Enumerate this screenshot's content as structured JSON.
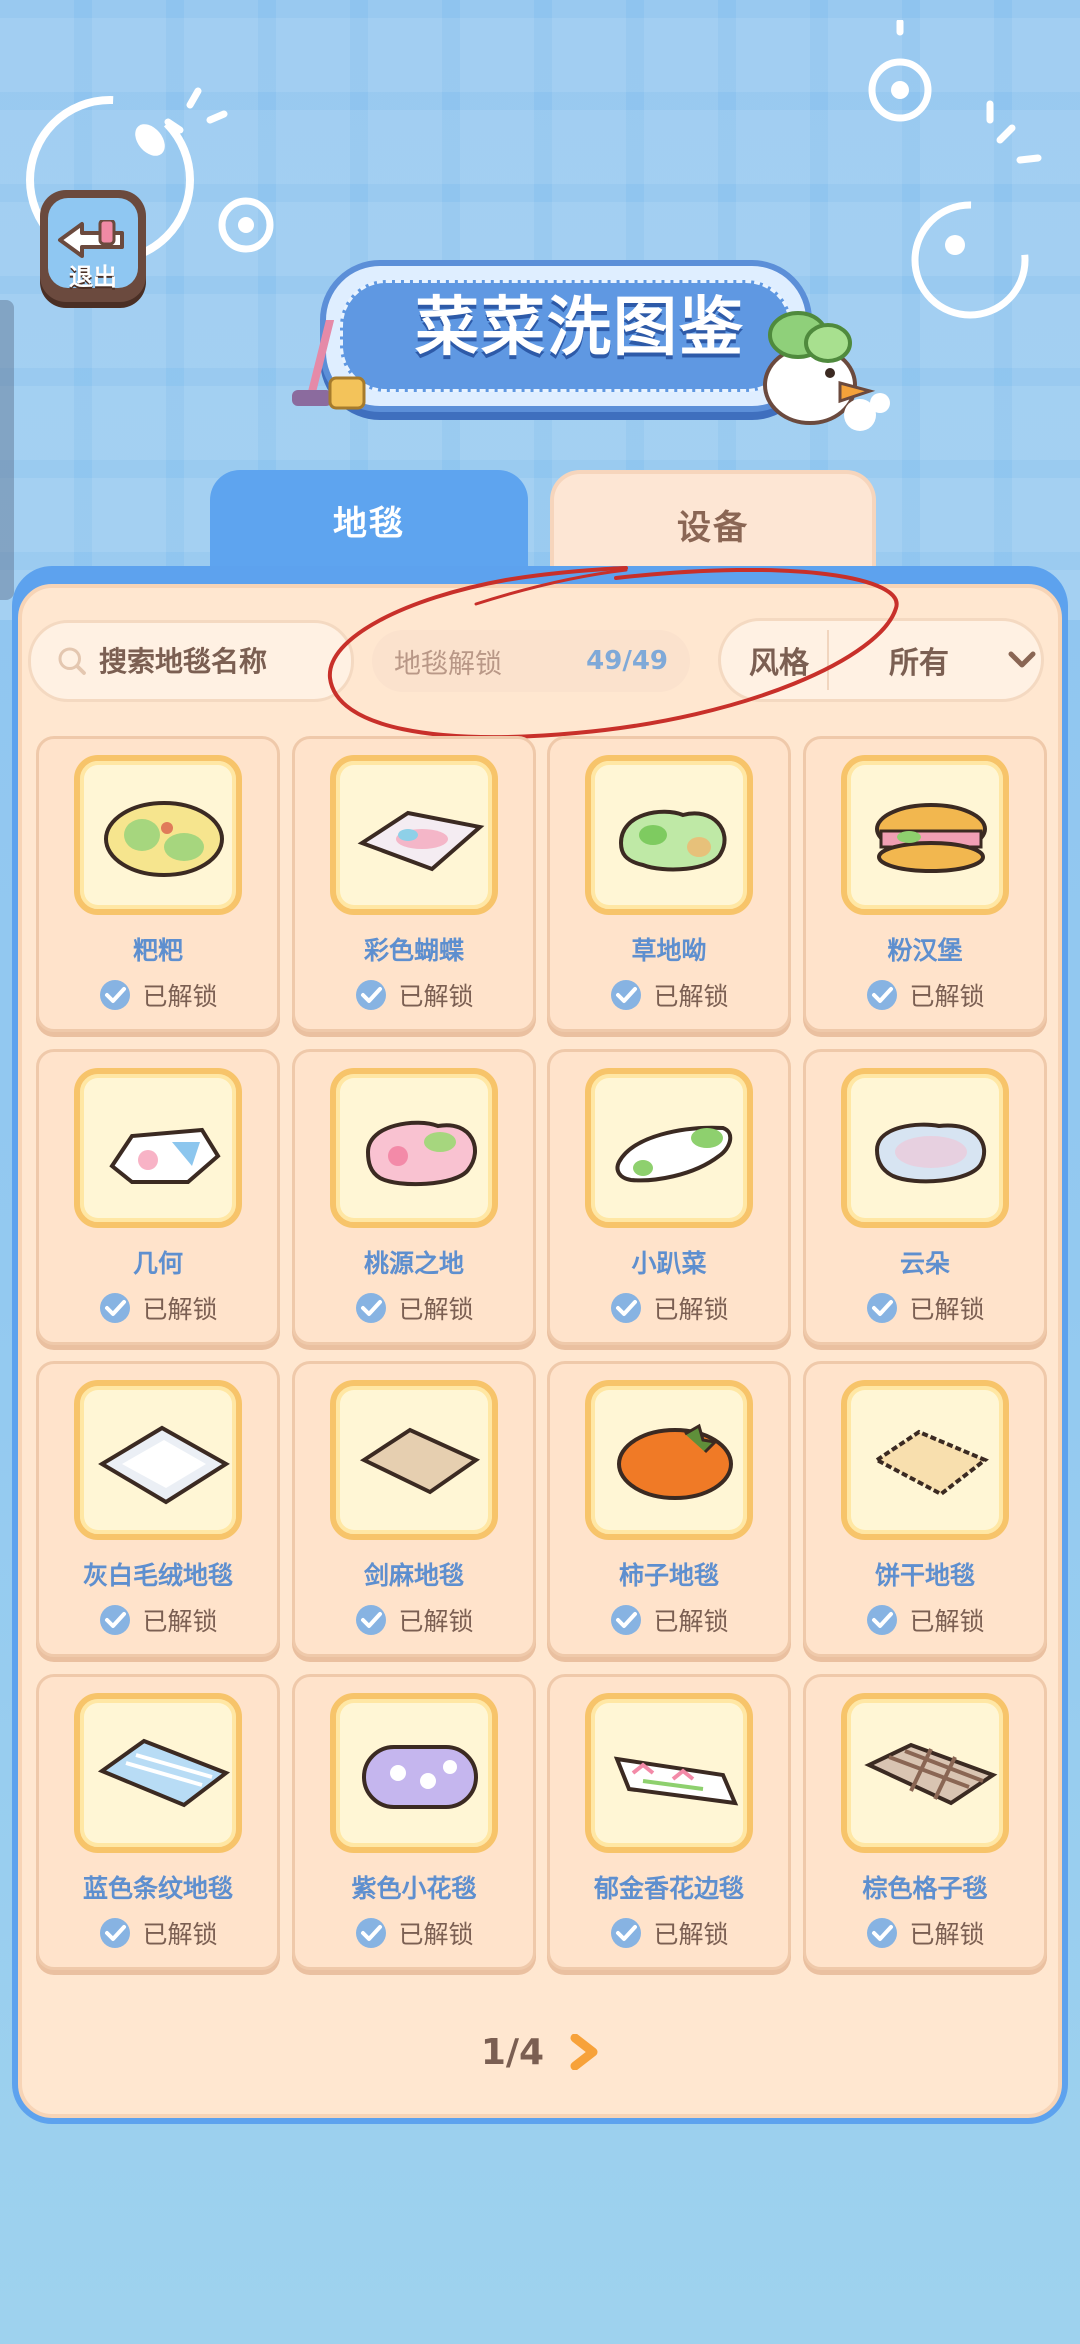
{
  "header": {
    "exit_label": "退出",
    "title": "菜菜洗图鉴"
  },
  "tabs": [
    {
      "label": "地毯",
      "active": true
    },
    {
      "label": "设备",
      "active": false
    }
  ],
  "filters": {
    "search_placeholder": "搜索地毯名称",
    "unlock_label": "地毯解锁",
    "unlock_count": "49/49",
    "style_label": "风格",
    "style_value": "所有"
  },
  "items": [
    {
      "name": "粑粑",
      "status": "已解锁",
      "icon": "rug-blob-yellow-icon"
    },
    {
      "name": "彩色蝴蝶",
      "status": "已解锁",
      "icon": "rug-butterfly-icon"
    },
    {
      "name": "草地呦",
      "status": "已解锁",
      "icon": "rug-grass-icon"
    },
    {
      "name": "粉汉堡",
      "status": "已解锁",
      "icon": "rug-burger-icon"
    },
    {
      "name": "几何",
      "status": "已解锁",
      "icon": "rug-geometric-icon"
    },
    {
      "name": "桃源之地",
      "status": "已解锁",
      "icon": "rug-peach-land-icon"
    },
    {
      "name": "小趴菜",
      "status": "已解锁",
      "icon": "rug-cabbage-icon"
    },
    {
      "name": "云朵",
      "status": "已解锁",
      "icon": "rug-cloud-icon"
    },
    {
      "name": "灰白毛绒地毯",
      "status": "已解锁",
      "icon": "rug-plush-white-icon"
    },
    {
      "name": "剑麻地毯",
      "status": "已解锁",
      "icon": "rug-sisal-icon"
    },
    {
      "name": "柿子地毯",
      "status": "已解锁",
      "icon": "rug-persimmon-icon"
    },
    {
      "name": "饼干地毯",
      "status": "已解锁",
      "icon": "rug-biscuit-icon"
    },
    {
      "name": "蓝色条纹地毯",
      "status": "已解锁",
      "icon": "rug-blue-stripe-icon"
    },
    {
      "name": "紫色小花毯",
      "status": "已解锁",
      "icon": "rug-purple-flower-icon"
    },
    {
      "name": "郁金香花边毯",
      "status": "已解锁",
      "icon": "rug-tulip-icon"
    },
    {
      "name": "棕色格子毯",
      "status": "已解锁",
      "icon": "rug-brown-check-icon"
    }
  ],
  "pagination": {
    "label": "1/4"
  },
  "colors": {
    "accent_blue": "#5ea4ef",
    "panel_bg": "#ffe7d0",
    "name_text": "#5e8fcf",
    "annotation_red": "#c8302a"
  }
}
